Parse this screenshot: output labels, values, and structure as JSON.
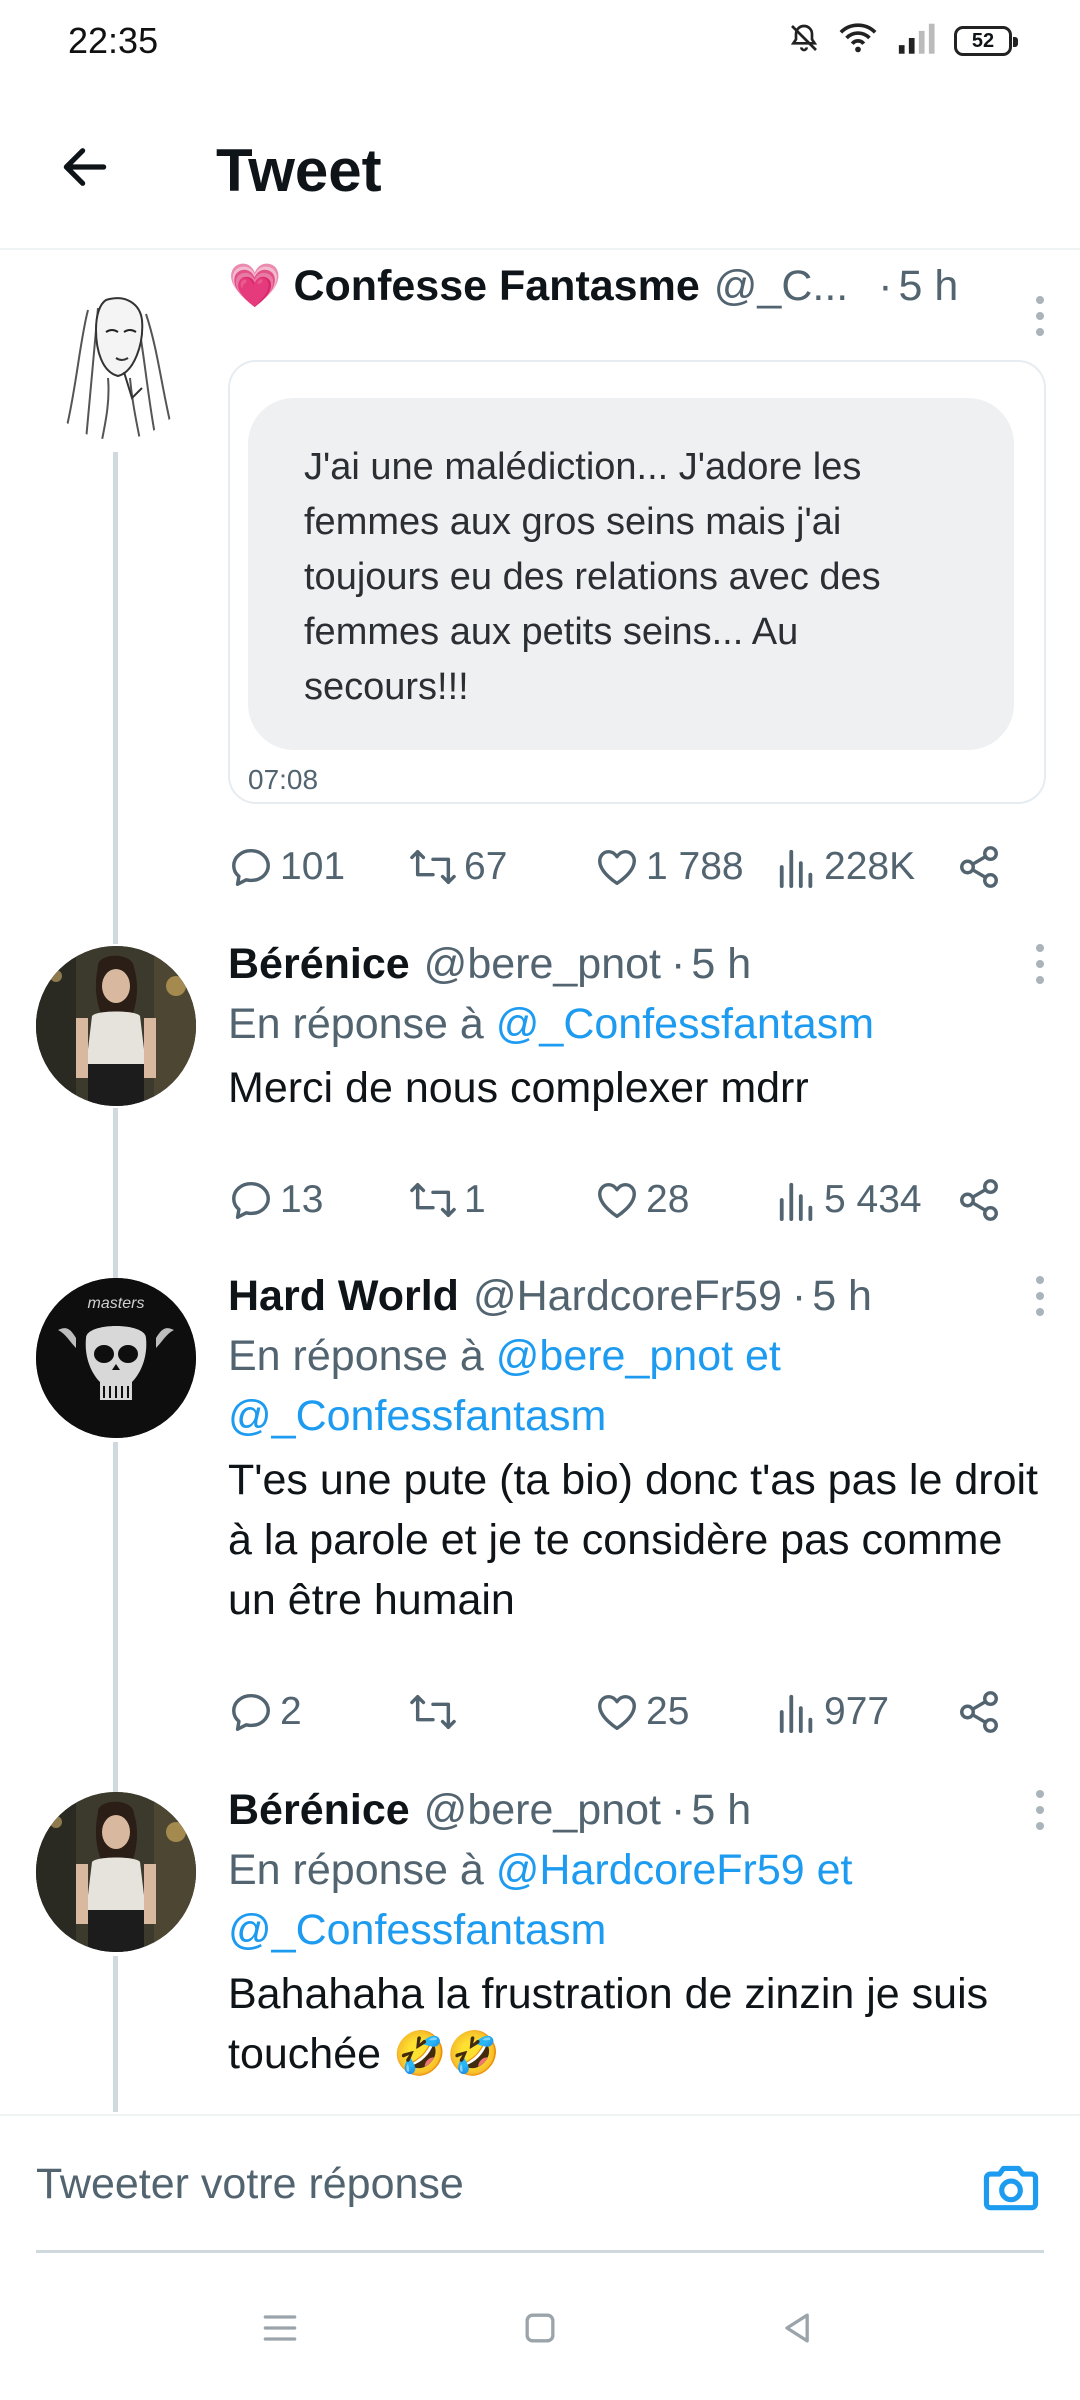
{
  "status_bar": {
    "time": "22:35",
    "battery": "52"
  },
  "header": {
    "title": "Tweet"
  },
  "tweets": [
    {
      "display_name": "💗 Confesse Fantasme",
      "handle": "@_C...",
      "dot": "·",
      "time": "5 h",
      "image_text": "J'ai une malédiction... J'adore les femmes aux gros seins mais j'ai toujours eu des relations avec des femmes aux petits seins... Au secours!!!",
      "image_time": "07:08",
      "replies": "101",
      "retweets": "67",
      "likes": "1 788",
      "views": "228K"
    },
    {
      "display_name": "Bérénice",
      "handle": "@bere_pnot",
      "dot": "·",
      "time": "5 h",
      "reply_prefix": "En réponse à",
      "reply_targets": "@_Confessfantasm",
      "text": "Merci de nous complexer mdrr",
      "replies": "13",
      "retweets": "1",
      "likes": "28",
      "views": "5 434"
    },
    {
      "display_name": "Hard World",
      "handle": "@HardcoreFr59",
      "dot": "·",
      "time": "5 h",
      "reply_prefix": "En réponse à",
      "reply_targets_line1": "@bere_pnot et",
      "reply_targets_line2": "@_Confessfantasm",
      "text": "T'es une pute (ta bio) donc t'as pas le droit à la parole et je te considère pas comme un être humain",
      "replies": "2",
      "retweets": "",
      "likes": "25",
      "views": "977"
    },
    {
      "display_name": "Bérénice",
      "handle": "@bere_pnot",
      "dot": "·",
      "time": "5 h",
      "reply_prefix": "En réponse à",
      "reply_targets_line1": "@HardcoreFr59 et",
      "reply_targets_line2": "@_Confessfantasm",
      "text": "Bahahaha la frustration de zinzin je suis touchée 🤣🤣"
    }
  ],
  "compose": {
    "placeholder": "Tweeter votre réponse"
  },
  "colors": {
    "accent": "#1d9bf0",
    "muted": "#536471",
    "thread_line": "#cfd9de"
  }
}
